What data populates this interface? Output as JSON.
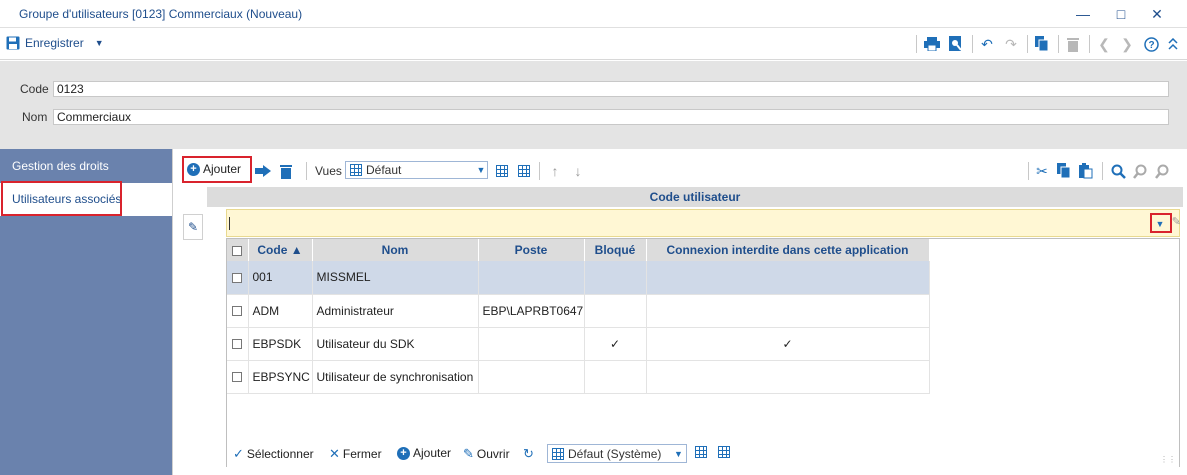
{
  "window": {
    "title": "Groupe d'utilisateurs [0123] Commerciaux (Nouveau)"
  },
  "toolbar": {
    "save_label": "Enregistrer"
  },
  "form": {
    "code_label": "Code",
    "code_value": "0123",
    "nom_label": "Nom",
    "nom_value": "Commerciaux"
  },
  "sidebar": {
    "items": [
      {
        "label": "Gestion des droits",
        "active": false
      },
      {
        "label": "Utilisateurs associés",
        "active": true
      }
    ]
  },
  "grid_toolbar": {
    "add_label": "Ajouter",
    "views_label": "Vues",
    "views_selected": "Défaut"
  },
  "grid": {
    "column_header": "Code utilisateur",
    "filter_value": ""
  },
  "popup": {
    "columns": [
      "Code",
      "Nom",
      "Poste",
      "Bloqué",
      "Connexion interdite dans cette application"
    ],
    "rows": [
      {
        "code": "001",
        "nom": "MISSMEL",
        "poste": "",
        "bloque": false,
        "connexion": false,
        "selected": true
      },
      {
        "code": "ADM",
        "nom": "Administrateur",
        "poste": "EBP\\LAPRBT0647",
        "bloque": false,
        "connexion": false,
        "selected": false
      },
      {
        "code": "EBPSDK",
        "nom": "Utilisateur du SDK",
        "poste": "",
        "bloque": true,
        "connexion": true,
        "selected": false
      },
      {
        "code": "EBPSYNC",
        "nom": "Utilisateur de synchronisation",
        "poste": "",
        "bloque": false,
        "connexion": false,
        "selected": false
      }
    ],
    "footer": {
      "select_label": "Sélectionner",
      "close_label": "Fermer",
      "add_label": "Ajouter",
      "open_label": "Ouvrir",
      "view_selected": "Défaut (Système)"
    }
  },
  "colors": {
    "accent": "#1f6fb8",
    "nav_bg": "#6a82ad",
    "highlight_border": "#d9232d"
  }
}
